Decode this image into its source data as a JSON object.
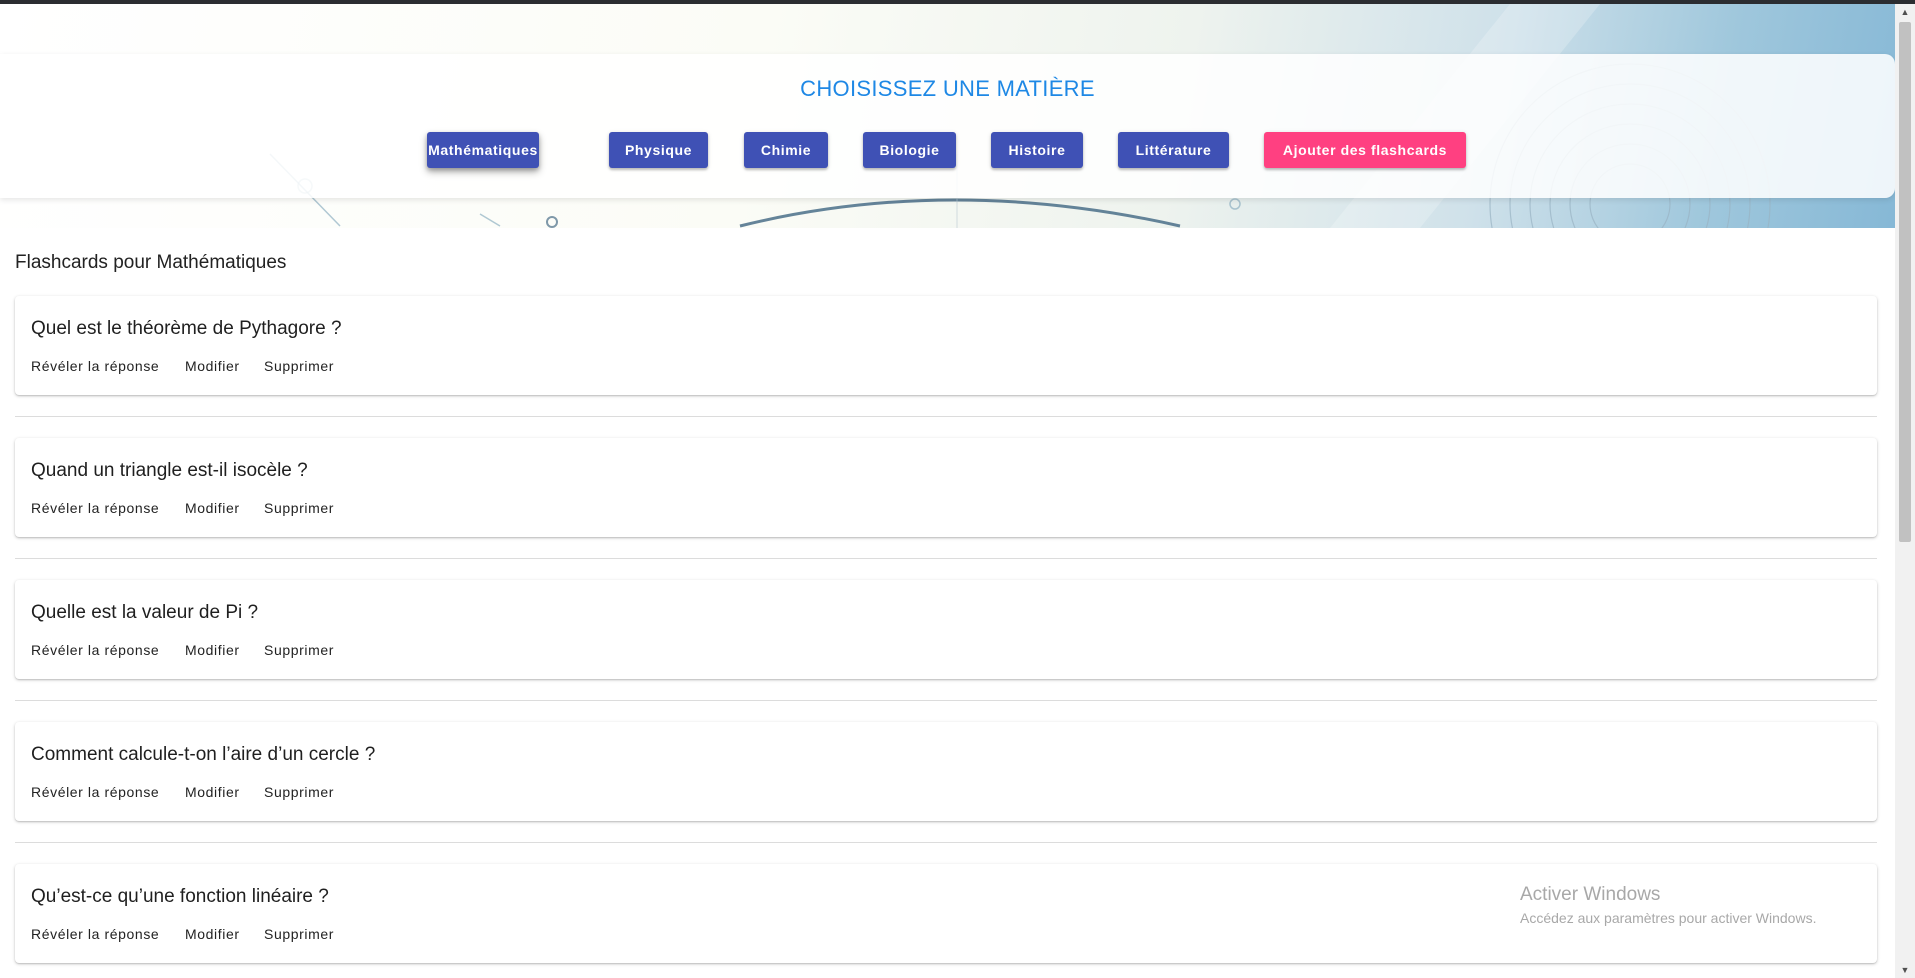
{
  "header": {
    "title": "CHOISISSEZ UNE MATIÈRE",
    "subjects": [
      "Mathématiques",
      "Physique",
      "Chimie",
      "Biologie",
      "Histoire",
      "Littérature"
    ],
    "add_button": "Ajouter des flashcards",
    "active_subject": "Mathématiques"
  },
  "colors": {
    "title_blue": "#1e88e5",
    "button_indigo": "#3f51b5",
    "button_pink": "#ff4081"
  },
  "flashcards": {
    "section_title": "Flashcards pour Mathématiques",
    "actions": {
      "reveal": "Révéler la réponse",
      "edit": "Modifier",
      "delete": "Supprimer"
    },
    "cards": [
      {
        "question": "Quel est le théorème de Pythagore ?"
      },
      {
        "question": "Quand un triangle est-il isocèle ?"
      },
      {
        "question": "Quelle est la valeur de Pi ?"
      },
      {
        "question": "Comment calcule-t-on l’aire d’un cercle ?"
      },
      {
        "question": "Qu’est-ce qu’une fonction linéaire ?"
      }
    ]
  },
  "watermark": {
    "title": "Activer Windows",
    "subtitle": "Accédez aux paramètres pour activer Windows."
  },
  "scrollbar": {
    "up_icon": "arrow-up-icon",
    "down_icon": "arrow-down-icon"
  }
}
